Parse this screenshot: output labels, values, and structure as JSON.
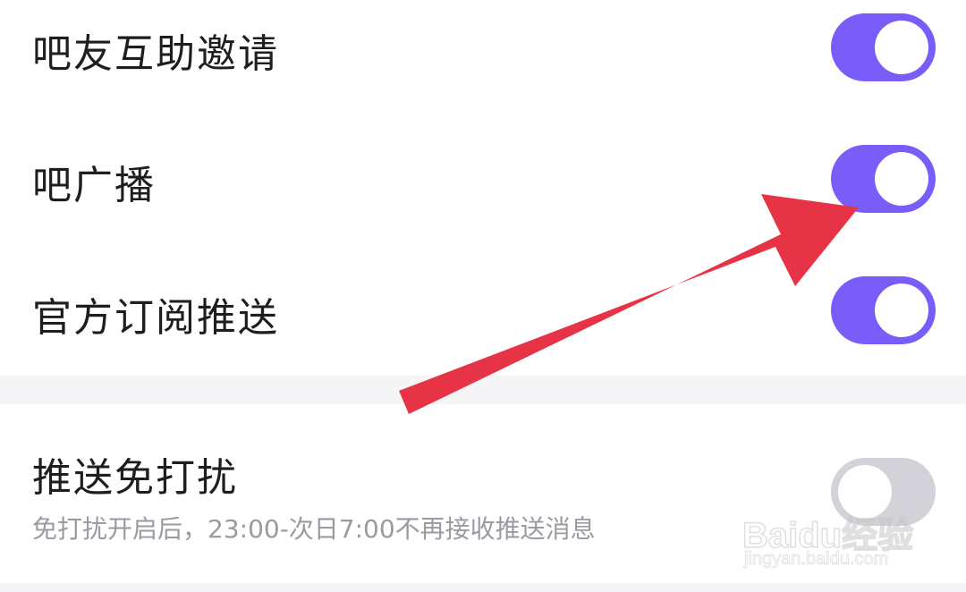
{
  "settings": {
    "items": [
      {
        "label": "吧友互助邀请",
        "enabled": true
      },
      {
        "label": "吧广播",
        "enabled": true
      },
      {
        "label": "官方订阅推送",
        "enabled": true
      }
    ],
    "dnd": {
      "label": "推送免打扰",
      "description": "免打扰开启后，23:00-次日7:00不再接收推送消息",
      "enabled": false
    }
  },
  "colors": {
    "toggle_on": "#7a5cf8",
    "toggle_off": "#d2d2d8",
    "annotation_arrow": "#e63346",
    "section_gap": "#f5f5f7"
  },
  "watermark": {
    "logo": "Baidu经验",
    "url": "jingyan.baidu.com"
  }
}
